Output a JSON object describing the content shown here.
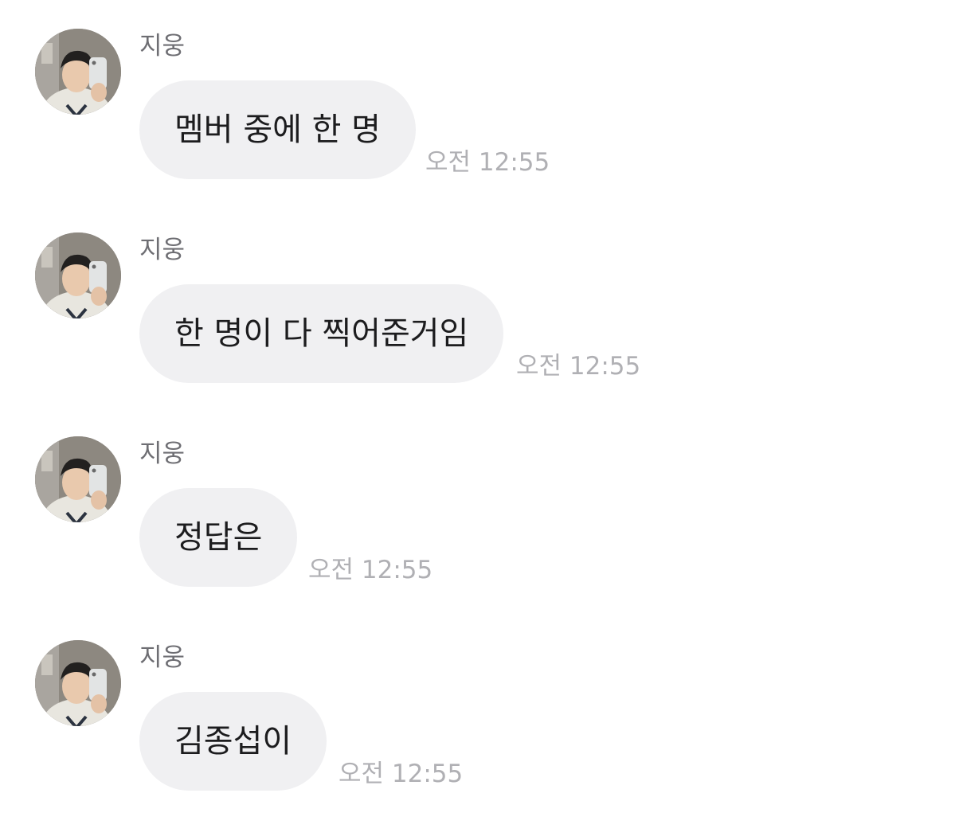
{
  "messages": [
    {
      "sender": "지웅",
      "text": "멤버 중에 한 명",
      "time": "오전 12:55"
    },
    {
      "sender": "지웅",
      "text": "한 명이 다 찍어준거임",
      "time": "오전 12:55"
    },
    {
      "sender": "지웅",
      "text": "정답은",
      "time": "오전 12:55"
    },
    {
      "sender": "지웅",
      "text": "김종섭이",
      "time": "오전 12:55"
    }
  ]
}
